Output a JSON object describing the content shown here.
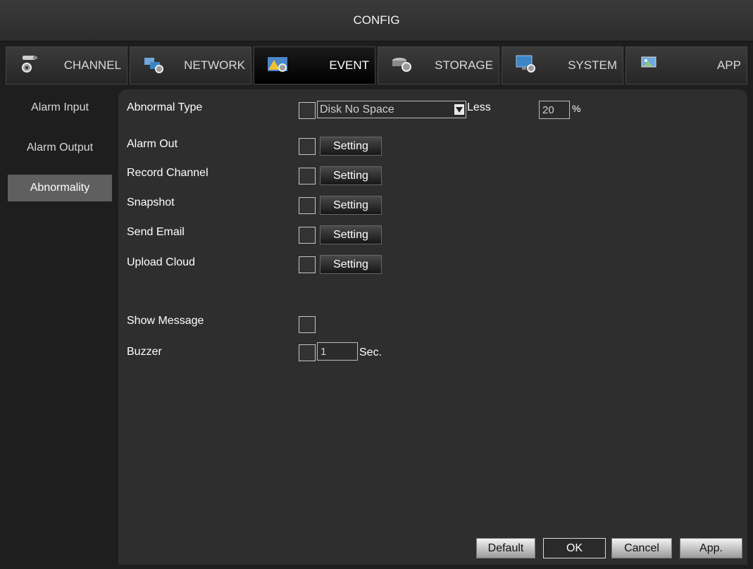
{
  "window": {
    "title": "CONFIG"
  },
  "tabs": [
    {
      "label": "CHANNEL",
      "icon": "channel-icon"
    },
    {
      "label": "NETWORK",
      "icon": "network-icon"
    },
    {
      "label": "EVENT",
      "icon": "event-icon",
      "active": true
    },
    {
      "label": "STORAGE",
      "icon": "storage-icon"
    },
    {
      "label": "SYSTEM",
      "icon": "system-icon"
    },
    {
      "label": "APP",
      "icon": "app-icon"
    }
  ],
  "sidebar": {
    "items": [
      {
        "label": "Alarm Input"
      },
      {
        "label": "Alarm Output"
      },
      {
        "label": "Abnormality",
        "active": true
      }
    ]
  },
  "form": {
    "abnormal_type": {
      "label": "Abnormal Type",
      "checked": false,
      "selected": "Disk No Space",
      "less_label": "Less",
      "percent_value": "20",
      "percent_unit": "%"
    },
    "setting_rows": [
      {
        "label": "Alarm Out",
        "checked": false,
        "button": "Setting"
      },
      {
        "label": "Record Channel",
        "checked": false,
        "button": "Setting"
      },
      {
        "label": "Snapshot",
        "checked": false,
        "button": "Setting"
      },
      {
        "label": "Send Email",
        "checked": false,
        "button": "Setting"
      },
      {
        "label": "Upload Cloud",
        "checked": false,
        "button": "Setting"
      }
    ],
    "show_message": {
      "label": "Show Message",
      "checked": false
    },
    "buzzer": {
      "label": "Buzzer",
      "checked": false,
      "value": "1",
      "unit": "Sec."
    }
  },
  "buttons": {
    "default": "Default",
    "ok": "OK",
    "cancel": "Cancel",
    "apply": "App."
  },
  "colors": {
    "background": "#1e1e1e",
    "panel": "#2e2e2e",
    "active_tab": "#000000",
    "sidebar_active": "#5f5f5f"
  }
}
